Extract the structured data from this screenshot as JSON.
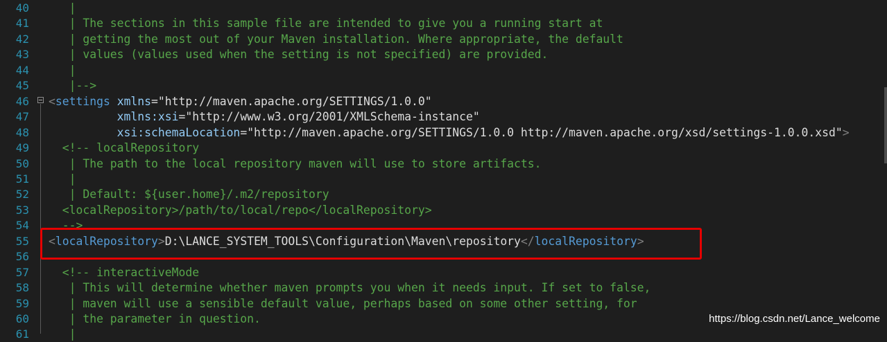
{
  "lines": [
    {
      "n": "40",
      "segs": [
        {
          "t": "   |",
          "c": "cmt"
        }
      ]
    },
    {
      "n": "41",
      "segs": [
        {
          "t": "   | The sections in this sample file are intended to give you a running start at",
          "c": "cmt"
        }
      ]
    },
    {
      "n": "42",
      "segs": [
        {
          "t": "   | getting the most out of your Maven installation. Where appropriate, the default",
          "c": "cmt"
        }
      ]
    },
    {
      "n": "43",
      "segs": [
        {
          "t": "   | values (values used when the setting is not specified) are provided.",
          "c": "cmt"
        }
      ]
    },
    {
      "n": "44",
      "segs": [
        {
          "t": "   |",
          "c": "cmt"
        }
      ]
    },
    {
      "n": "45",
      "segs": [
        {
          "t": "   |-->",
          "c": "cmt"
        }
      ]
    },
    {
      "n": "46",
      "segs": [
        {
          "t": "<",
          "c": "punct"
        },
        {
          "t": "settings",
          "c": "tag"
        },
        {
          "t": " xmlns",
          "c": "attr"
        },
        {
          "t": "=",
          "c": "str"
        },
        {
          "t": "\"http://maven.apache.org/SETTINGS/1.0.0\"",
          "c": "str"
        }
      ]
    },
    {
      "n": "47",
      "segs": [
        {
          "t": "          xmlns:xsi",
          "c": "attr"
        },
        {
          "t": "=",
          "c": "str"
        },
        {
          "t": "\"http://www.w3.org/2001/XMLSchema-instance\"",
          "c": "str"
        }
      ]
    },
    {
      "n": "48",
      "segs": [
        {
          "t": "          xsi:schemaLocation",
          "c": "attr"
        },
        {
          "t": "=",
          "c": "str"
        },
        {
          "t": "\"http://maven.apache.org/SETTINGS/1.0.0 http://maven.apache.org/xsd/settings-1.0.0.xsd\"",
          "c": "str"
        },
        {
          "t": ">",
          "c": "punct"
        }
      ]
    },
    {
      "n": "49",
      "segs": [
        {
          "t": "  <!-- localRepository",
          "c": "cmt"
        }
      ]
    },
    {
      "n": "50",
      "segs": [
        {
          "t": "   | The path to the local repository maven will use to store artifacts.",
          "c": "cmt"
        }
      ]
    },
    {
      "n": "51",
      "segs": [
        {
          "t": "   |",
          "c": "cmt"
        }
      ]
    },
    {
      "n": "52",
      "segs": [
        {
          "t": "   | Default: ${user.home}/.m2/repository",
          "c": "cmt"
        }
      ]
    },
    {
      "n": "53",
      "segs": [
        {
          "t": "  <localRepository>/path/to/local/repo</localRepository>",
          "c": "cmt"
        }
      ]
    },
    {
      "n": "54",
      "segs": [
        {
          "t": "  -->",
          "c": "cmt"
        }
      ]
    },
    {
      "n": "55",
      "segs": [
        {
          "t": "<",
          "c": "punct"
        },
        {
          "t": "localRepository",
          "c": "tag"
        },
        {
          "t": ">",
          "c": "punct"
        },
        {
          "t": "D:\\LANCE_SYSTEM_TOOLS\\Configuration\\Maven\\repository",
          "c": "str"
        },
        {
          "t": "</",
          "c": "punct"
        },
        {
          "t": "localRepository",
          "c": "tag"
        },
        {
          "t": ">",
          "c": "punct"
        }
      ]
    },
    {
      "n": "56",
      "segs": []
    },
    {
      "n": "57",
      "segs": [
        {
          "t": "  <!-- interactiveMode",
          "c": "cmt"
        }
      ]
    },
    {
      "n": "58",
      "segs": [
        {
          "t": "   | This will determine whether maven prompts you when it needs input. If set to false,",
          "c": "cmt"
        }
      ]
    },
    {
      "n": "59",
      "segs": [
        {
          "t": "   | maven will use a sensible default value, perhaps based on some other setting, for",
          "c": "cmt"
        }
      ]
    },
    {
      "n": "60",
      "segs": [
        {
          "t": "   | the parameter in question.",
          "c": "cmt"
        }
      ]
    },
    {
      "n": "61",
      "segs": [
        {
          "t": "   |",
          "c": "cmt"
        }
      ]
    }
  ],
  "watermark": "https://blog.csdn.net/Lance_welcome"
}
